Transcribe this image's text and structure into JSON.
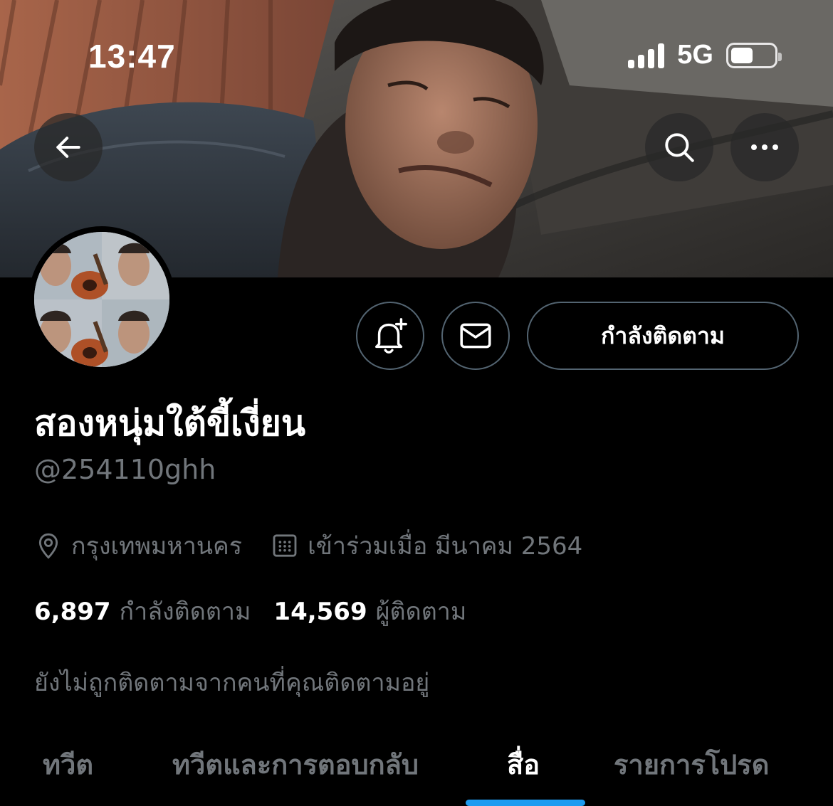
{
  "status_bar": {
    "time": "13:47",
    "network": "5G",
    "battery_level": 0.52
  },
  "header": {
    "back_icon": "arrow-left-icon",
    "search_icon": "search-icon",
    "more_icon": "more-dots-icon"
  },
  "actions": {
    "notify_icon": "bell-plus-icon",
    "message_icon": "envelope-icon",
    "following_label": "กำลังติดตาม"
  },
  "profile": {
    "display_name": "สองหนุ่มใต้ขี้เงี่ยน",
    "handle": "@254110ghh",
    "location": "กรุงเทพมหานคร",
    "joined": "เข้าร่วมเมื่อ มีนาคม 2564",
    "following_count": "6,897",
    "following_label": "กำลังติดตาม",
    "followers_count": "14,569",
    "followers_label": "ผู้ติดตาม",
    "followed_by_text": "ยังไม่ถูกติดตามจากคนที่คุณติดตามอยู่"
  },
  "tabs": [
    {
      "label": "ทวีต",
      "active": false
    },
    {
      "label": "ทวีตและการตอบกลับ",
      "active": false
    },
    {
      "label": "สื่อ",
      "active": true
    },
    {
      "label": "รายการโปรด",
      "active": false
    }
  ],
  "colors": {
    "background": "#000000",
    "text_primary": "#e7e9ea",
    "text_secondary": "#71767b",
    "border": "#536471",
    "accent": "#1d9bf0"
  }
}
